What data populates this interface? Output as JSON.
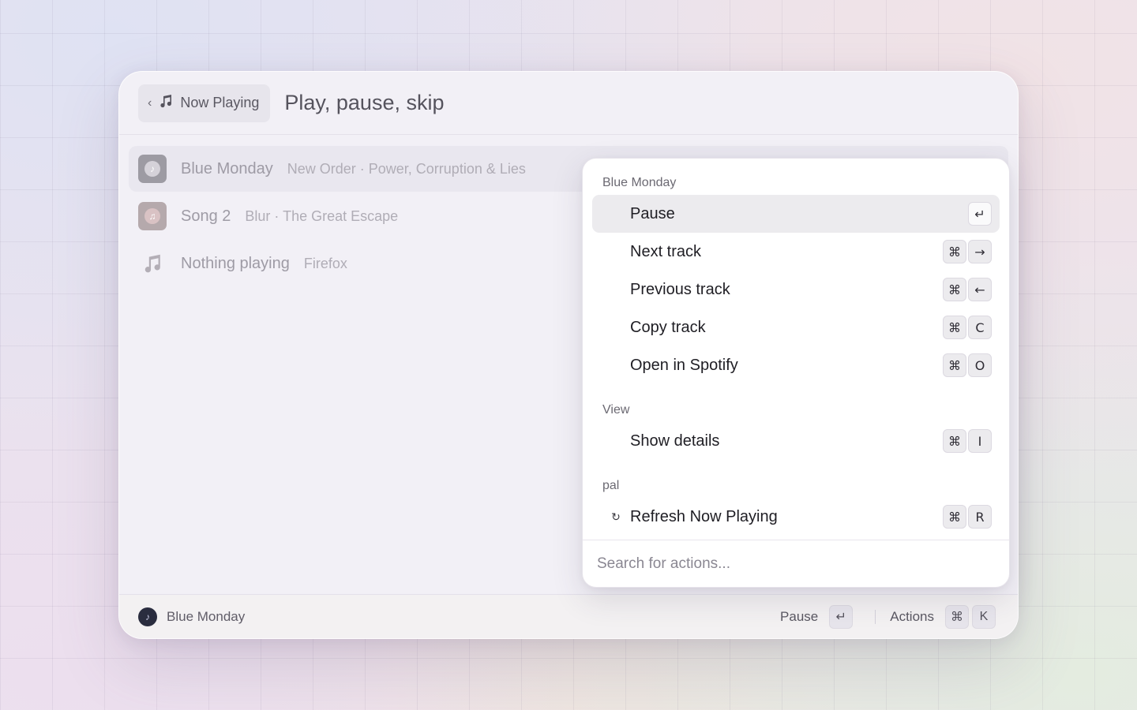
{
  "header": {
    "back_label": "Now Playing",
    "back_chevron": "‹",
    "title": "Play, pause, skip"
  },
  "list": [
    {
      "name": "Blue Monday",
      "subtitle": "New Order · Power, Corruption & Lies",
      "icon": "album-art-icon",
      "selected": true
    },
    {
      "name": "Song 2",
      "subtitle": "Blur · The Great Escape",
      "icon": "album-art-icon",
      "selected": false
    },
    {
      "name": "Nothing playing",
      "subtitle": "Firefox",
      "icon": "music-note-icon",
      "selected": false
    }
  ],
  "actions_menu": {
    "sections": [
      {
        "title": "Blue Monday",
        "items": [
          {
            "label": "Pause",
            "keys": [
              "↵"
            ],
            "active": true
          },
          {
            "label": "Next track",
            "keys": [
              "⌘",
              "→"
            ]
          },
          {
            "label": "Previous track",
            "keys": [
              "⌘",
              "←"
            ]
          },
          {
            "label": "Copy track",
            "keys": [
              "⌘",
              "C"
            ]
          },
          {
            "label": "Open in Spotify",
            "keys": [
              "⌘",
              "O"
            ]
          }
        ]
      },
      {
        "title": "View",
        "items": [
          {
            "label": "Show details",
            "keys": [
              "⌘",
              "I"
            ]
          }
        ]
      },
      {
        "title": "pal",
        "items": [
          {
            "label": "Refresh Now Playing",
            "icon": "↻",
            "keys": [
              "⌘",
              "R"
            ]
          }
        ]
      }
    ],
    "search_placeholder": "Search for actions..."
  },
  "footer": {
    "current_track": "Blue Monday",
    "primary_action": "Pause",
    "primary_key": "↵",
    "actions_label": "Actions",
    "actions_keys": [
      "⌘",
      "K"
    ]
  }
}
